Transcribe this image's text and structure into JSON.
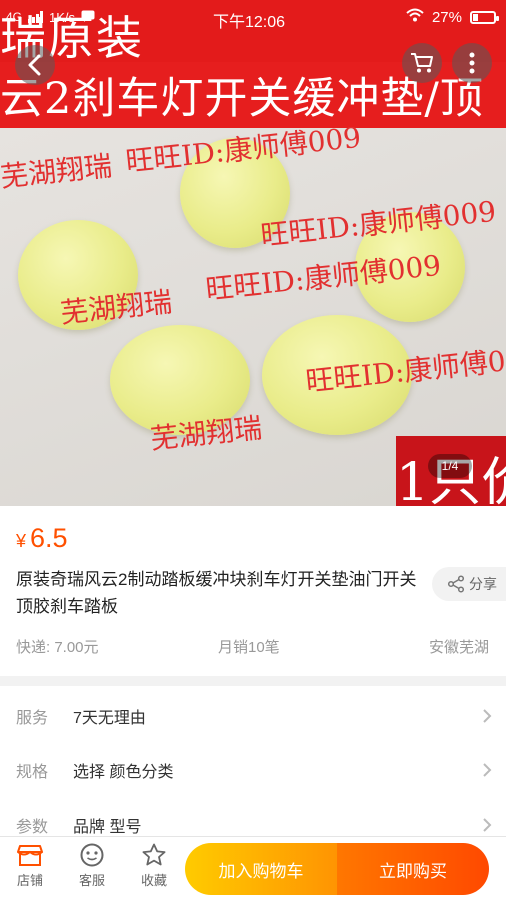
{
  "status_bar": {
    "network": "4G",
    "speed": "1K/s",
    "time": "下午12:06",
    "battery": "27%",
    "battery_level": 0.27
  },
  "hero": {
    "banner_line1": "瑞原装",
    "banner_line2": "云2刹车灯开关缓冲垫/顶",
    "corner_text": "1只价",
    "watermarks": [
      "芜湖翔瑞",
      "旺旺ID:康师傅009",
      "芜湖翔瑞",
      "旺旺ID:康师傅009",
      "芜湖翔瑞",
      "旺旺ID:康师傅009",
      "芜湖翔瑞"
    ],
    "pager": "1/4"
  },
  "product": {
    "currency": "¥",
    "price": "6.5",
    "title": "原装奇瑞风云2制动踏板缓冲块刹车灯开关垫油门开关顶胶刹车踏板",
    "share_label": "分享",
    "shipping": "快递: 7.00元",
    "monthly_sales": "月销10笔",
    "location": "安徽芜湖"
  },
  "specs": [
    {
      "label": "服务",
      "value": "7天无理由"
    },
    {
      "label": "规格",
      "value": "选择 颜色分类"
    },
    {
      "label": "参数",
      "value": "品牌 型号"
    }
  ],
  "bottom_bar": {
    "shop_label": "店铺",
    "service_label": "客服",
    "favorite_label": "收藏",
    "add_to_cart": "加入购物车",
    "buy_now": "立即购买"
  },
  "colors": {
    "accent": "#ff5000",
    "banner_red": "#e31b1b",
    "cart_button": "#ffa000",
    "buy_button": "#ff5a00"
  }
}
